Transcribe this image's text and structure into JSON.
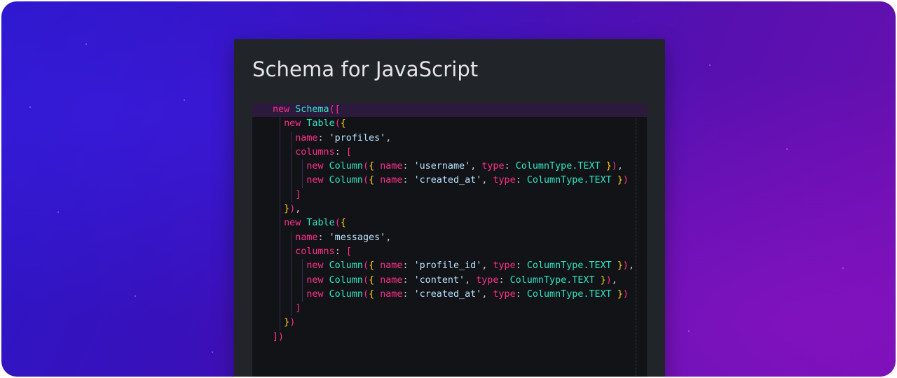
{
  "card": {
    "title": "Schema for JavaScript"
  },
  "code": {
    "language": "JavaScript",
    "lines": [
      [
        {
          "t": "new ",
          "c": "kw"
        },
        {
          "t": "Schema",
          "c": "cls"
        },
        {
          "t": "([",
          "c": "br2"
        }
      ],
      [
        {
          "t": "  new ",
          "c": "kw"
        },
        {
          "t": "Table",
          "c": "cls"
        },
        {
          "t": "(",
          "c": "br2"
        },
        {
          "t": "{",
          "c": "br"
        }
      ],
      [
        {
          "t": "    name",
          "c": "prop"
        },
        {
          "t": ": ",
          "c": "punc"
        },
        {
          "t": "'profiles'",
          "c": "str"
        },
        {
          "t": ",",
          "c": "punc"
        }
      ],
      [
        {
          "t": "    columns",
          "c": "prop"
        },
        {
          "t": ": ",
          "c": "punc"
        },
        {
          "t": "[",
          "c": "br2"
        }
      ],
      [
        {
          "t": "      new ",
          "c": "kw"
        },
        {
          "t": "Column",
          "c": "cls"
        },
        {
          "t": "(",
          "c": "br2"
        },
        {
          "t": "{ ",
          "c": "br"
        },
        {
          "t": "name",
          "c": "prop"
        },
        {
          "t": ": ",
          "c": "punc"
        },
        {
          "t": "'username'",
          "c": "str"
        },
        {
          "t": ", ",
          "c": "punc"
        },
        {
          "t": "type",
          "c": "prop"
        },
        {
          "t": ": ",
          "c": "punc"
        },
        {
          "t": "ColumnType",
          "c": "cls"
        },
        {
          "t": ".TEXT ",
          "c": "cls"
        },
        {
          "t": "}",
          "c": "br"
        },
        {
          "t": ")",
          "c": "br2"
        },
        {
          "t": ",",
          "c": "punc"
        }
      ],
      [
        {
          "t": "      new ",
          "c": "kw"
        },
        {
          "t": "Column",
          "c": "cls"
        },
        {
          "t": "(",
          "c": "br2"
        },
        {
          "t": "{ ",
          "c": "br"
        },
        {
          "t": "name",
          "c": "prop"
        },
        {
          "t": ": ",
          "c": "punc"
        },
        {
          "t": "'created_at'",
          "c": "str"
        },
        {
          "t": ", ",
          "c": "punc"
        },
        {
          "t": "type",
          "c": "prop"
        },
        {
          "t": ": ",
          "c": "punc"
        },
        {
          "t": "ColumnType",
          "c": "cls"
        },
        {
          "t": ".TEXT ",
          "c": "cls"
        },
        {
          "t": "}",
          "c": "br"
        },
        {
          "t": ")",
          "c": "br2"
        }
      ],
      [
        {
          "t": "    ]",
          "c": "br2"
        }
      ],
      [
        {
          "t": "  }",
          "c": "br"
        },
        {
          "t": ")",
          "c": "br2"
        },
        {
          "t": ",",
          "c": "punc"
        }
      ],
      [
        {
          "t": "  new ",
          "c": "kw"
        },
        {
          "t": "Table",
          "c": "cls"
        },
        {
          "t": "(",
          "c": "br2"
        },
        {
          "t": "{",
          "c": "br"
        }
      ],
      [
        {
          "t": "    name",
          "c": "prop"
        },
        {
          "t": ": ",
          "c": "punc"
        },
        {
          "t": "'messages'",
          "c": "str"
        },
        {
          "t": ",",
          "c": "punc"
        }
      ],
      [
        {
          "t": "    columns",
          "c": "prop"
        },
        {
          "t": ": ",
          "c": "punc"
        },
        {
          "t": "[",
          "c": "br2"
        }
      ],
      [
        {
          "t": "      new ",
          "c": "kw"
        },
        {
          "t": "Column",
          "c": "cls"
        },
        {
          "t": "(",
          "c": "br2"
        },
        {
          "t": "{ ",
          "c": "br"
        },
        {
          "t": "name",
          "c": "prop"
        },
        {
          "t": ": ",
          "c": "punc"
        },
        {
          "t": "'profile_id'",
          "c": "str"
        },
        {
          "t": ", ",
          "c": "punc"
        },
        {
          "t": "type",
          "c": "prop"
        },
        {
          "t": ": ",
          "c": "punc"
        },
        {
          "t": "ColumnType",
          "c": "cls"
        },
        {
          "t": ".TEXT ",
          "c": "cls"
        },
        {
          "t": "}",
          "c": "br"
        },
        {
          "t": ")",
          "c": "br2"
        },
        {
          "t": ",",
          "c": "punc"
        }
      ],
      [
        {
          "t": "      new ",
          "c": "kw"
        },
        {
          "t": "Column",
          "c": "cls"
        },
        {
          "t": "(",
          "c": "br2"
        },
        {
          "t": "{ ",
          "c": "br"
        },
        {
          "t": "name",
          "c": "prop"
        },
        {
          "t": ": ",
          "c": "punc"
        },
        {
          "t": "'content'",
          "c": "str"
        },
        {
          "t": ", ",
          "c": "punc"
        },
        {
          "t": "type",
          "c": "prop"
        },
        {
          "t": ": ",
          "c": "punc"
        },
        {
          "t": "ColumnType",
          "c": "cls"
        },
        {
          "t": ".TEXT ",
          "c": "cls"
        },
        {
          "t": "}",
          "c": "br"
        },
        {
          "t": ")",
          "c": "br2"
        },
        {
          "t": ",",
          "c": "punc"
        }
      ],
      [
        {
          "t": "      new ",
          "c": "kw"
        },
        {
          "t": "Column",
          "c": "cls"
        },
        {
          "t": "(",
          "c": "br2"
        },
        {
          "t": "{ ",
          "c": "br"
        },
        {
          "t": "name",
          "c": "prop"
        },
        {
          "t": ": ",
          "c": "punc"
        },
        {
          "t": "'created_at'",
          "c": "str"
        },
        {
          "t": ", ",
          "c": "punc"
        },
        {
          "t": "type",
          "c": "prop"
        },
        {
          "t": ": ",
          "c": "punc"
        },
        {
          "t": "ColumnType",
          "c": "cls"
        },
        {
          "t": ".TEXT ",
          "c": "cls"
        },
        {
          "t": "}",
          "c": "br"
        },
        {
          "t": ")",
          "c": "br2"
        }
      ],
      [
        {
          "t": "    ]",
          "c": "br2"
        }
      ],
      [
        {
          "t": "  }",
          "c": "br"
        },
        {
          "t": ")",
          "c": "br2"
        }
      ],
      [
        {
          "t": "])",
          "c": "br2"
        }
      ]
    ]
  },
  "colors": {
    "keyword": "#ff2e8c",
    "class": "#2ee6c4",
    "brace": "#ffd21e",
    "string": "#b9e3ff",
    "editor_background": "#121317",
    "card_background": "#212429"
  }
}
